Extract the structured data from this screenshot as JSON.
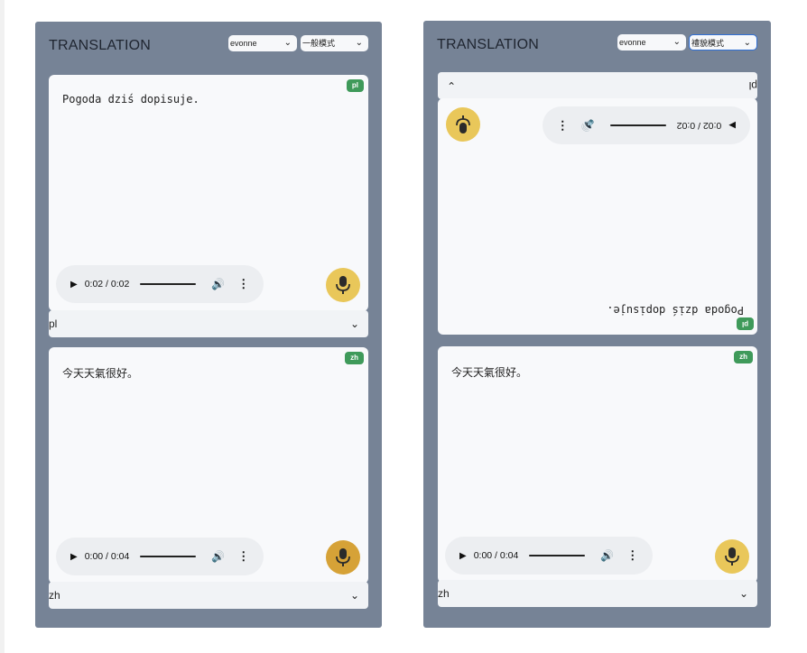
{
  "left_panel": {
    "title": "TRANSLATION",
    "user_select": "evonne",
    "mode_select": "一般模式",
    "top_card": {
      "tag": "pl",
      "text": "Pogoda dziś dopisuje.",
      "audio_time": "0:02 / 0:02",
      "lang_value": "pl"
    },
    "bottom_card": {
      "tag": "zh",
      "text": "今天天氣很好。",
      "audio_time": "0:00 / 0:04",
      "lang_value": "zh"
    }
  },
  "right_panel": {
    "title": "TRANSLATION",
    "user_select": "evonne",
    "mode_select": "禮貌模式",
    "top_card": {
      "tag": "pl",
      "text": "Pogoda dziś dopisuje.",
      "audio_time": "0:02 / 0:02",
      "lang_value": "pl"
    },
    "bottom_card": {
      "tag": "zh",
      "text": "今天天氣很好。",
      "audio_time": "0:00 / 0:04",
      "lang_value": "zh"
    }
  },
  "colors": {
    "panel_bg": "#768396",
    "card_bg": "#f8f9fb",
    "tag_green": "#3f9a5a",
    "mic_yellow": "#e9c75a",
    "mic_yellow_active": "#d6a237"
  },
  "icons": {
    "play": "play-icon",
    "volume": "volume-icon",
    "more": "more-vertical-icon",
    "mic": "microphone-icon",
    "chevron": "chevron-down-icon"
  }
}
